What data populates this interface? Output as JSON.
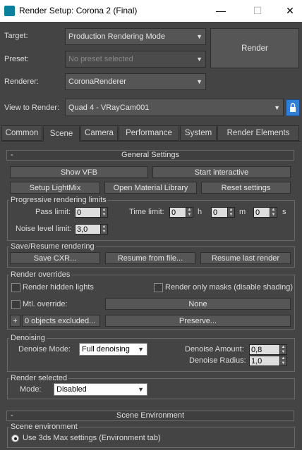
{
  "window": {
    "title": "Render Setup: Corona 2 (Final)",
    "minimize": "—",
    "maximize": "☐",
    "close": "✕"
  },
  "header": {
    "target_label": "Target:",
    "target_value": "Production Rendering Mode",
    "preset_label": "Preset:",
    "preset_value": "No preset selected",
    "renderer_label": "Renderer:",
    "renderer_value": "CoronaRenderer",
    "view_label": "View to Render:",
    "view_value": "Quad 4 - VRayCam001",
    "render_button": "Render"
  },
  "tabs": [
    {
      "label": "Common"
    },
    {
      "label": "Scene"
    },
    {
      "label": "Camera"
    },
    {
      "label": "Performance"
    },
    {
      "label": "System"
    },
    {
      "label": "Render Elements"
    }
  ],
  "general": {
    "title": "General Settings",
    "collapse": "-",
    "show_vfb": "Show VFB",
    "start_interactive": "Start interactive",
    "setup_lightmix": "Setup LightMix",
    "open_material_library": "Open Material Library",
    "reset_settings": "Reset settings",
    "progressive_title": "Progressive rendering limits",
    "pass_limit_label": "Pass limit:",
    "pass_limit_value": "0",
    "time_limit_label": "Time limit:",
    "time_h": "0",
    "h": "h",
    "time_m": "0",
    "m": "m",
    "time_s": "0",
    "s": "s",
    "noise_label": "Noise level limit:",
    "noise_value": "3,0",
    "save_title": "Save/Resume rendering",
    "save_cxr": "Save CXR...",
    "resume_file": "Resume from file...",
    "resume_last": "Resume last render",
    "overrides_title": "Render overrides",
    "render_hidden_lights": "Render hidden lights",
    "render_only_masks": "Render only masks (disable shading)",
    "mtl_override": "Mtl. override:",
    "none_button": "None",
    "plus": "+",
    "objects_excluded": "0 objects excluded...",
    "preserve": "Preserve...",
    "denoising_title": "Denoising",
    "denoise_mode_label": "Denoise Mode:",
    "denoise_mode_value": "Full denoising",
    "denoise_amount_label": "Denoise Amount:",
    "denoise_amount_value": "0,8",
    "denoise_radius_label": "Denoise Radius:",
    "denoise_radius_value": "1,0",
    "render_selected_title": "Render selected",
    "mode_label": "Mode:",
    "mode_value": "Disabled"
  },
  "scene_env": {
    "title": "Scene Environment",
    "collapse": "-",
    "group_title": "Scene environment",
    "use_3ds_max": "Use 3ds Max settings (Environment tab)"
  },
  "icons": {
    "app": "render-setup-app-icon",
    "lock": "lock-icon",
    "arrow": "chevron-down-icon"
  },
  "colors": {
    "panel": "#444444",
    "accent_lock": "#2f7fd6",
    "logo": "#0a7f9e"
  }
}
